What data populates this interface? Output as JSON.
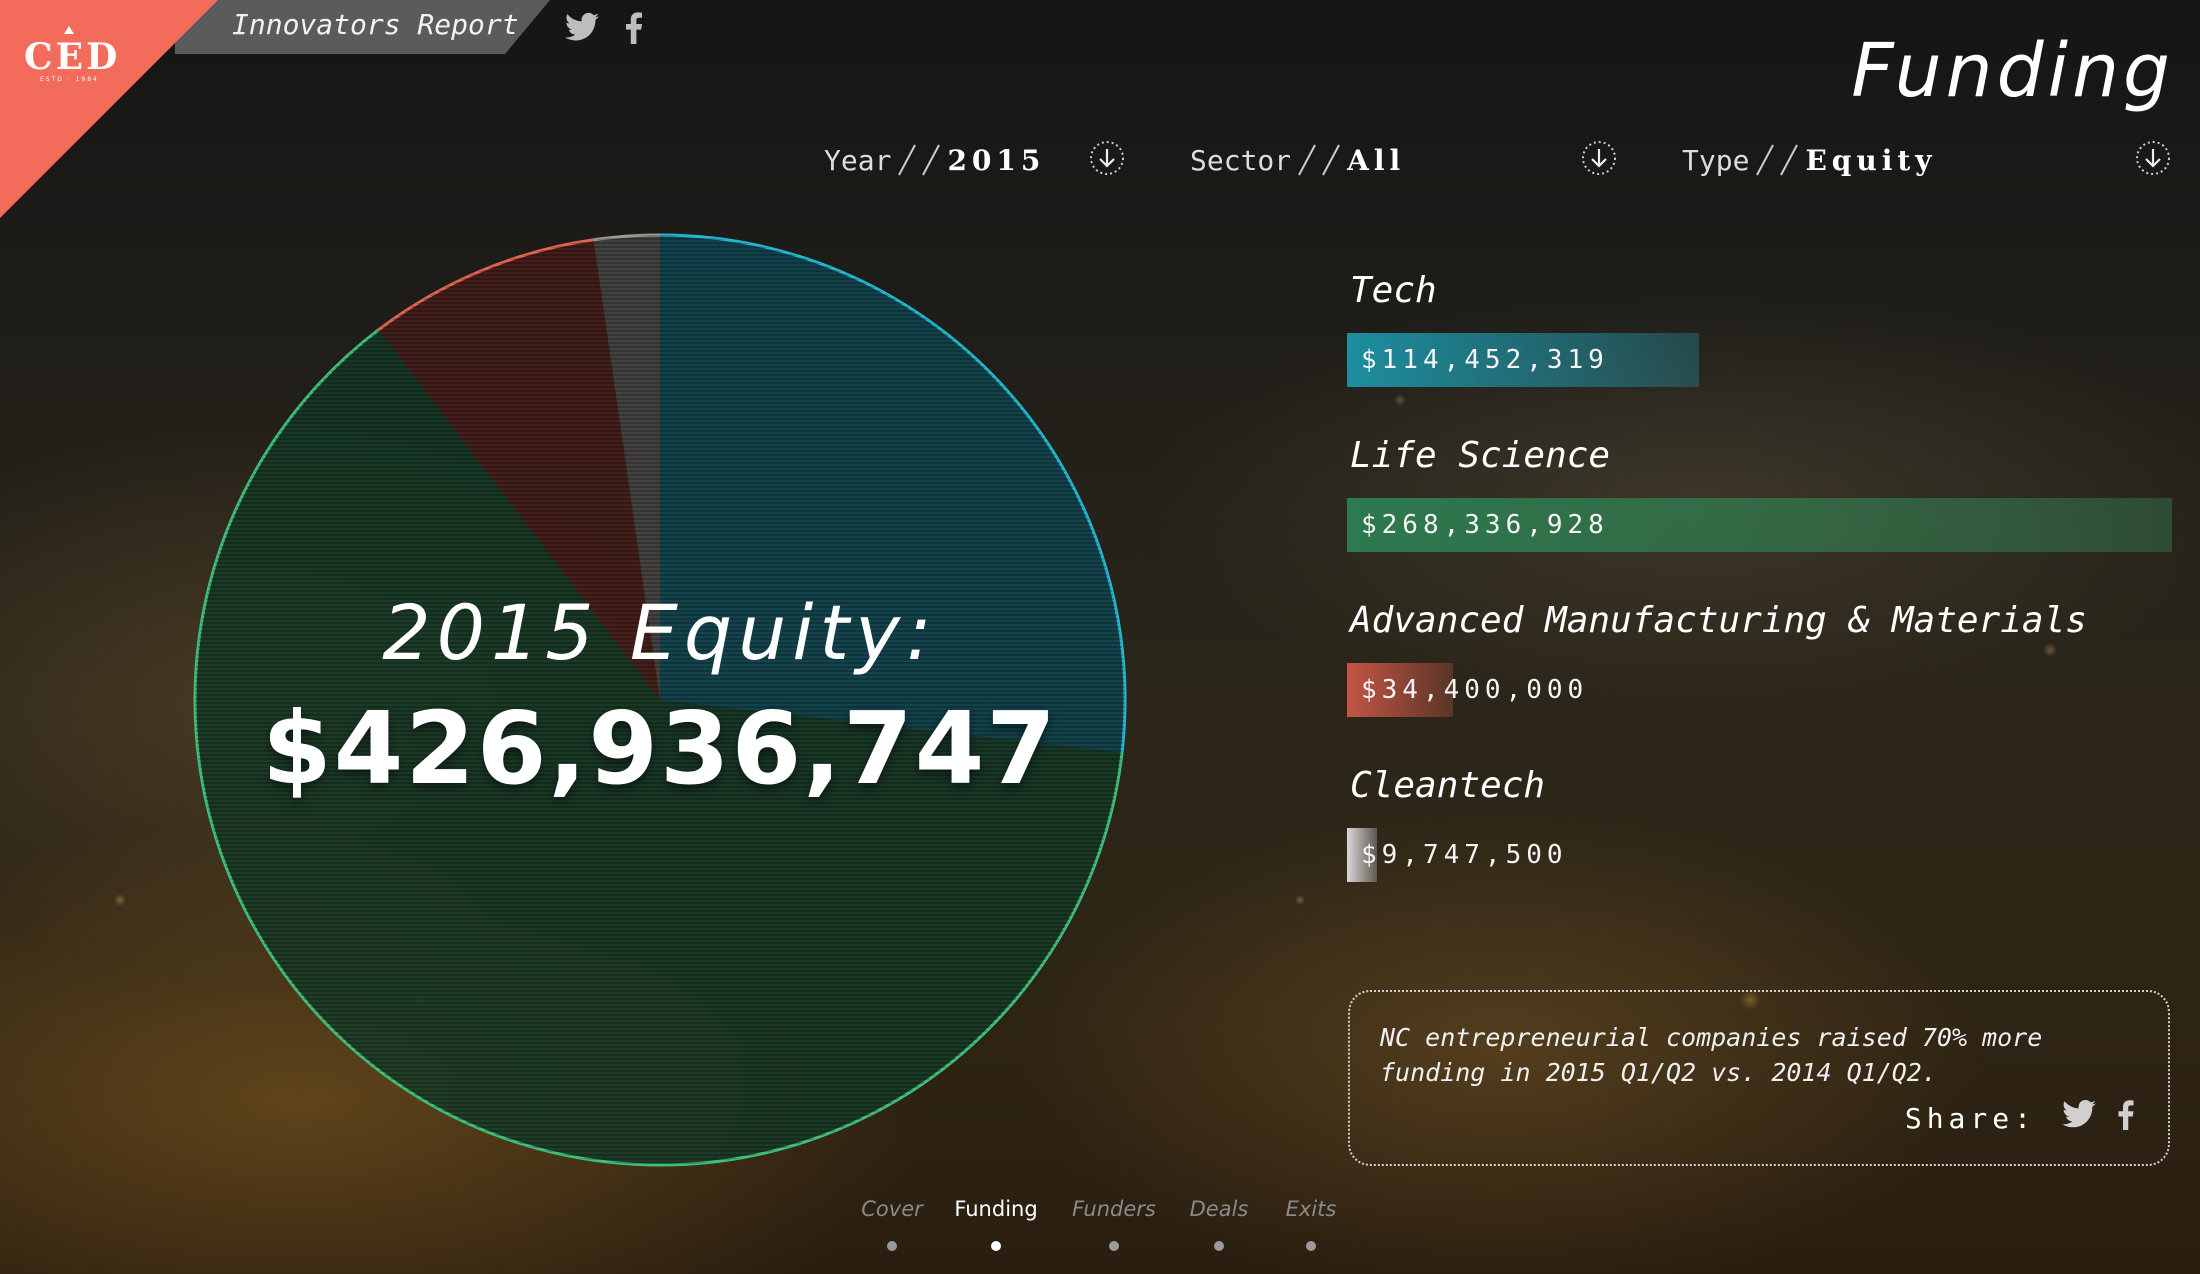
{
  "brand": {
    "logo_text": "CED",
    "logo_sub": "ESTD · 1984",
    "report_title": "Innovators Report"
  },
  "header": {
    "page_title": "Funding",
    "social_icons": [
      "twitter-icon",
      "facebook-icon"
    ]
  },
  "filters": [
    {
      "label": "Year",
      "value": "2015"
    },
    {
      "label": "Sector",
      "value": "All"
    },
    {
      "label": "Type",
      "value": "Equity"
    }
  ],
  "summary": {
    "heading": "2015 Equity:",
    "total": "$426,936,747"
  },
  "chart_data": {
    "type": "pie",
    "title": "2015 Equity:",
    "categories": [
      "Tech",
      "Life Science",
      "Advanced Manufacturing & Materials",
      "Cleantech"
    ],
    "values": [
      114452319,
      268336928,
      34400000,
      9747500
    ],
    "labels": [
      "$114,452,319",
      "$268,336,928",
      "$34,400,000",
      "$9,747,500"
    ],
    "colors": [
      "#23b8d2",
      "#3fbf7a",
      "#e0644f",
      "#9a9a9a"
    ],
    "total": "$426,936,747"
  },
  "share": {
    "text": "NC entrepreneurial companies raised 70% more funding in 2015 Q1/Q2 vs. 2014 Q1/Q2.",
    "label": "Share:"
  },
  "nav": {
    "items": [
      "Cover",
      "Funding",
      "Funders",
      "Deals",
      "Exits"
    ],
    "active": "Funding"
  }
}
